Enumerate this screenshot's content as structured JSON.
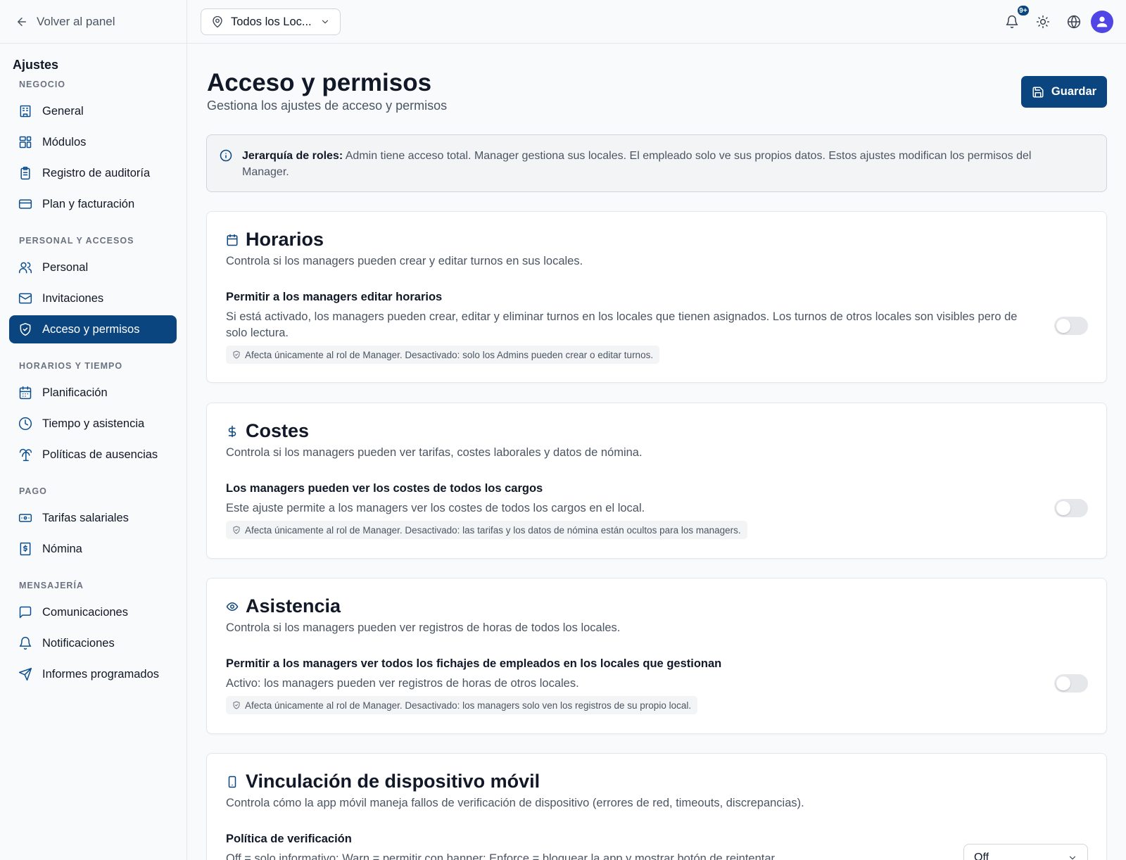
{
  "sidebar": {
    "back_label": "Volver al panel",
    "title": "Ajustes",
    "sections": [
      {
        "label": "NEGOCIO",
        "items": [
          {
            "label": "General",
            "icon": "building-icon"
          },
          {
            "label": "Módulos",
            "icon": "modules-icon"
          },
          {
            "label": "Registro de auditoría",
            "icon": "clipboard-icon"
          },
          {
            "label": "Plan y facturación",
            "icon": "credit-card-icon"
          }
        ]
      },
      {
        "label": "PERSONAL Y ACCESOS",
        "items": [
          {
            "label": "Personal",
            "icon": "users-icon"
          },
          {
            "label": "Invitaciones",
            "icon": "mail-icon"
          },
          {
            "label": "Acceso y permisos",
            "icon": "shield-check-icon",
            "active": true
          }
        ]
      },
      {
        "label": "HORARIOS Y TIEMPO",
        "items": [
          {
            "label": "Planificación",
            "icon": "calendar-icon"
          },
          {
            "label": "Tiempo y asistencia",
            "icon": "clock-icon"
          },
          {
            "label": "Políticas de ausencias",
            "icon": "palm-tree-icon"
          }
        ]
      },
      {
        "label": "PAGO",
        "items": [
          {
            "label": "Tarifas salariales",
            "icon": "banknote-icon"
          },
          {
            "label": "Nómina",
            "icon": "receipt-icon"
          }
        ]
      },
      {
        "label": "MENSAJERÍA",
        "items": [
          {
            "label": "Comunicaciones",
            "icon": "message-square-icon"
          },
          {
            "label": "Notificaciones",
            "icon": "bell-icon"
          },
          {
            "label": "Informes programados",
            "icon": "send-icon"
          }
        ]
      }
    ]
  },
  "topbar": {
    "location_label": "Todos los Loc...",
    "notification_badge": "9+"
  },
  "page": {
    "title": "Acceso y permisos",
    "subtitle": "Gestiona los ajustes de acceso y permisos",
    "save_label": "Guardar",
    "info_bold": "Jerarquía de roles:",
    "info_text": "Admin tiene acceso total. Manager gestiona sus locales. El empleado solo ve sus propios datos. Estos ajustes modifican los permisos del Manager."
  },
  "cards": [
    {
      "title": "Horarios",
      "icon": "calendar-icon",
      "description": "Controla si los managers pueden crear y editar turnos en sus locales.",
      "setting_title": "Permitir a los managers editar horarios",
      "setting_description": "Si está activado, los managers pueden crear, editar y eliminar turnos en los locales que tienen asignados. Los turnos de otros locales son visibles pero de solo lectura.",
      "note": "Afecta únicamente al rol de Manager. Desactivado: solo los Admins pueden crear o editar turnos.",
      "enabled": false
    },
    {
      "title": "Costes",
      "icon": "dollar-icon",
      "description": "Controla si los managers pueden ver tarifas, costes laborales y datos de nómina.",
      "setting_title": "Los managers pueden ver los costes de todos los cargos",
      "setting_description": "Este ajuste permite a los managers ver los costes de todos los cargos en el local.",
      "note": "Afecta únicamente al rol de Manager. Desactivado: las tarifas y los datos de nómina están ocultos para los managers.",
      "enabled": false
    },
    {
      "title": "Asistencia",
      "icon": "eye-icon",
      "description": "Controla si los managers pueden ver registros de horas de todos los locales.",
      "setting_title": "Permitir a los managers ver todos los fichajes de empleados en los locales que gestionan",
      "setting_description": "Activo: los managers pueden ver registros de horas de otros locales.",
      "note": "Afecta únicamente al rol de Manager. Desactivado: los managers solo ven los registros de su propio local.",
      "enabled": false
    },
    {
      "title": "Vinculación de dispositivo móvil",
      "icon": "smartphone-icon",
      "description": "Controla cómo la app móvil maneja fallos de verificación de dispositivo (errores de red, timeouts, discrepancias).",
      "setting_title": "Política de verificación",
      "setting_description": "Off = solo informativo; Warn = permitir con banner; Enforce = bloquear la app y mostrar botón de reintentar",
      "select_value": "Off"
    }
  ]
}
